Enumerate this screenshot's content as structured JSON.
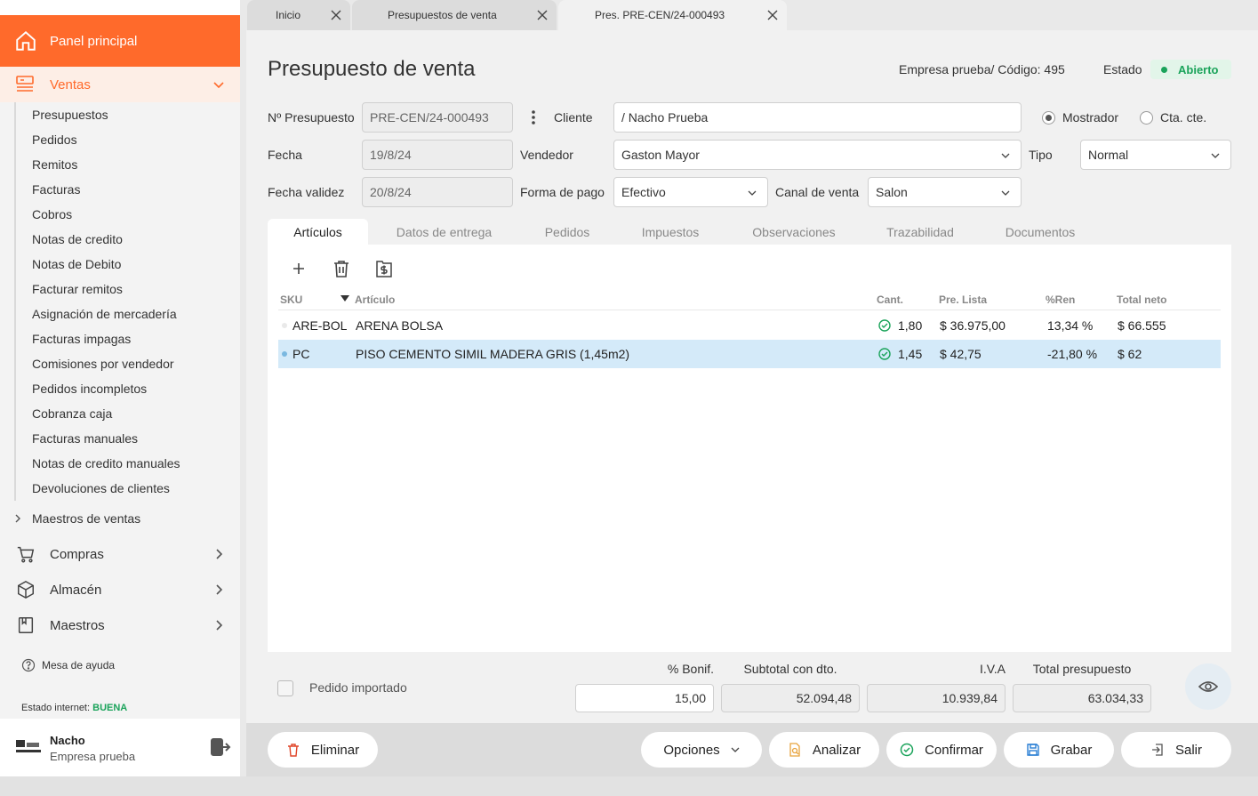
{
  "tabs": [
    {
      "label": "Inicio"
    },
    {
      "label": "Presupuestos de venta"
    },
    {
      "label": "Pres. PRE-CEN/24-000493"
    }
  ],
  "sidebar": {
    "panel_principal": "Panel principal",
    "ventas": "Ventas",
    "ventas_items": [
      "Presupuestos",
      "Pedidos",
      "Remitos",
      "Facturas",
      "Cobros",
      "Notas de credito",
      "Notas de Debito",
      "Facturar remitos",
      "Asignación de mercadería",
      "Facturas impagas",
      "Comisiones por vendedor",
      "Pedidos incompletos",
      "Cobranza caja",
      "Facturas manuales",
      "Notas de credito manuales",
      "Devoluciones de clientes"
    ],
    "maestros_ventas": "Maestros de ventas",
    "compras": "Compras",
    "almacen": "Almacén",
    "maestros": "Maestros",
    "mesa_ayuda": "Mesa de ayuda",
    "estado_internet_label": "Estado internet:",
    "estado_internet_value": "BUENA",
    "user_name": "Nacho",
    "user_company": "Empresa prueba",
    "accent_color": "#ff6a2b"
  },
  "header": {
    "title": "Presupuesto de venta",
    "empresa": "Empresa prueba/ Código: 495",
    "estado_label": "Estado",
    "estado_value": "Abierto"
  },
  "form": {
    "nro_label": "Nº Presupuesto",
    "nro_value": "PRE-CEN/24-000493",
    "cliente_label": "Cliente",
    "cliente_value": "/ Nacho Prueba",
    "radio_mostrador": "Mostrador",
    "radio_ctacte": "Cta. cte.",
    "fecha_label": "Fecha",
    "fecha_value": "19/8/24",
    "vendedor_label": "Vendedor",
    "vendedor_value": "Gaston Mayor",
    "tipo_label": "Tipo",
    "tipo_value": "Normal",
    "fecha_validez_label": "Fecha validez",
    "fecha_validez_value": "20/8/24",
    "forma_pago_label": "Forma de pago",
    "forma_pago_value": "Efectivo",
    "canal_label": "Canal de venta",
    "canal_value": "Salon"
  },
  "content_tabs": [
    "Artículos",
    "Datos de entrega",
    "Pedidos",
    "Impuestos",
    "Observaciones",
    "Trazabilidad",
    "Documentos"
  ],
  "table": {
    "headers": {
      "sku": "SKU",
      "articulo": "Artículo",
      "cant": "Cant.",
      "pre_lista": "Pre. Lista",
      "ren": "%Ren",
      "total": "Total neto"
    },
    "rows": [
      {
        "sku": "ARE-BOL",
        "articulo": "ARENA BOLSA",
        "cant": "1,80",
        "pre_lista": "$ 36.975,00",
        "ren": "13,34 %",
        "total": "$ 66.555"
      },
      {
        "sku": "PC",
        "articulo": "PISO CEMENTO SIMIL MADERA GRIS (1,45m2)",
        "cant": "1,45",
        "pre_lista": "$ 42,75",
        "ren": "-21,80 %",
        "total": "$ 62"
      }
    ]
  },
  "totals": {
    "pedido_importado": "Pedido importado",
    "bonif_label": "% Bonif.",
    "bonif_value": "15,00",
    "subtotal_label": "Subtotal con dto.",
    "subtotal_value": "52.094,48",
    "iva_label": "I.V.A",
    "iva_value": "10.939,84",
    "total_label": "Total presupuesto",
    "total_value": "63.034,33"
  },
  "footer": {
    "eliminar": "Eliminar",
    "opciones": "Opciones",
    "analizar": "Analizar",
    "confirmar": "Confirmar",
    "grabar": "Grabar",
    "salir": "Salir"
  }
}
